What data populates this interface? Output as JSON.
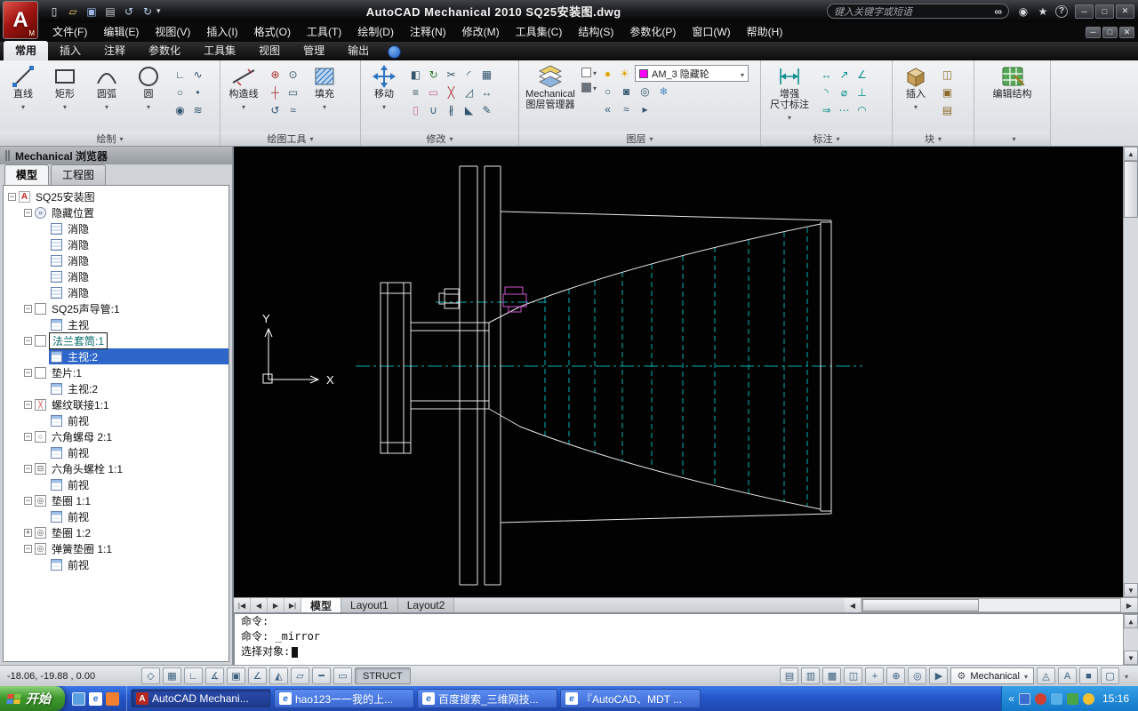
{
  "colors": {
    "selection_blue": "#2e66c9",
    "layer_swatch_magenta": "#ff00ff",
    "centerline_teal": "#00b3b3",
    "drawing_line_white": "#e6e6e6",
    "taskbar_blue": "#2457c9",
    "start_green": "#3f9c2e"
  },
  "title_bar": {
    "app_title": "AutoCAD Mechanical 2010  SQ25安装图.dwg",
    "search_placeholder": "键入关键字或短语",
    "qat_icons": [
      "qnew-icon",
      "open-icon",
      "save-icon",
      "plot-icon",
      "undo-icon",
      "redo-icon"
    ],
    "right_icons": [
      {
        "name": "communication-center-icon",
        "glyph": "◉"
      },
      {
        "name": "favorites-star-icon",
        "glyph": "★"
      },
      {
        "name": "help-icon",
        "glyph": "?"
      }
    ],
    "window_buttons": [
      {
        "name": "minimize-button",
        "glyph": "─"
      },
      {
        "name": "restore-button",
        "glyph": "□"
      },
      {
        "name": "close-button",
        "glyph": "✕"
      }
    ]
  },
  "menu_bar": {
    "items": [
      "文件(F)",
      "编辑(E)",
      "视图(V)",
      "插入(I)",
      "格式(O)",
      "工具(T)",
      "绘制(D)",
      "注释(N)",
      "修改(M)",
      "工具集(C)",
      "结构(S)",
      "参数化(P)",
      "窗口(W)",
      "帮助(H)"
    ],
    "child_window_buttons": [
      {
        "name": "child-minimize-button",
        "glyph": "─"
      },
      {
        "name": "child-restore-button",
        "glyph": "□"
      },
      {
        "name": "child-close-button",
        "glyph": "✕"
      }
    ]
  },
  "ribbon": {
    "tabs": [
      {
        "label": "常用",
        "active": true
      },
      {
        "label": "插入"
      },
      {
        "label": "注释"
      },
      {
        "label": "参数化"
      },
      {
        "label": "工具集"
      },
      {
        "label": "视图"
      },
      {
        "label": "管理"
      },
      {
        "label": "输出"
      }
    ],
    "panels": {
      "draw": {
        "label": "绘制",
        "line": "直线",
        "rect": "矩形",
        "arc": "圆弧",
        "circle": "圆",
        "small_icons": [
          "polyline-icon",
          "spline-icon",
          "ellipse-icon",
          "point-icon",
          "donut-icon",
          "revision-cloud-icon"
        ]
      },
      "drawtools": {
        "label": "绘图工具",
        "construction_line": "构造线",
        "hatch": "填充",
        "small_icons": [
          "centerline-cross-icon",
          "point-ref-icon",
          "centerline-icon",
          "rectangle-tool-icon",
          "undo-mark-icon",
          "zigzag-icon"
        ]
      },
      "modify": {
        "label": "修改",
        "move": "移动",
        "small_icons": [
          "mirror-icon",
          "rotate-icon",
          "trim-icon",
          "fillet-icon",
          "array-icon",
          "offset-icon",
          "erase-icon",
          "explode-icon",
          "scale-icon",
          "stretch-icon",
          "power-erase-icon",
          "join-icon",
          "break-icon",
          "chamfer-icon",
          "edit-poly-icon"
        ]
      },
      "layers": {
        "label": "图层",
        "manager_line1": "Mechanical",
        "manager_line2": "图层管理器",
        "layer_combo": "AM_3 隐藏轮",
        "row1_icons": [
          "bulb-icon",
          "sun-icon"
        ],
        "row2_icons": [
          "layer-off-icon",
          "layer-lock-icon",
          "layer-iso-icon",
          "freeze-icon"
        ],
        "row3_icons": [
          "layer-prev-icon",
          "layer-match-icon",
          "layer-walk-icon"
        ]
      },
      "annotate": {
        "label": "标注",
        "main_line1": "增强",
        "main_line2": "尺寸标注",
        "small_icons": [
          "dim-linear-icon",
          "dim-aligned-icon",
          "dim-angular-icon",
          "dim-radius-icon",
          "dim-diameter-icon",
          "dim-ordinate-icon",
          "dim-baseline-icon",
          "dim-chain-icon",
          "dim-arc-icon"
        ]
      },
      "block": {
        "label": "块",
        "insert": "插入",
        "small_icons": [
          "create-block-icon",
          "block-edit-icon",
          "attribute-icon"
        ]
      },
      "struct": {
        "label": "",
        "edit_structure": "编辑结构"
      }
    }
  },
  "browser_palette": {
    "title": "Mechanical 浏览器",
    "tabs": [
      {
        "label": "模型",
        "active": true
      },
      {
        "label": "工程图"
      }
    ],
    "tree": [
      {
        "level": 0,
        "exp": "minus",
        "icon": "am-drawing-icon",
        "label": "SQ25安装图"
      },
      {
        "level": 1,
        "exp": "minus",
        "icon": "hide-situation-icon",
        "label": "隐藏位置"
      },
      {
        "level": 2,
        "exp": "none",
        "icon": "hide-item-icon",
        "label": "消隐"
      },
      {
        "level": 2,
        "exp": "none",
        "icon": "hide-item-icon",
        "label": "消隐"
      },
      {
        "level": 2,
        "exp": "none",
        "icon": "hide-item-icon",
        "label": "消隐"
      },
      {
        "level": 2,
        "exp": "none",
        "icon": "hide-item-icon",
        "label": "消隐"
      },
      {
        "level": 2,
        "exp": "none",
        "icon": "hide-item-icon",
        "label": "消隐"
      },
      {
        "level": 1,
        "exp": "minus",
        "icon": "part-icon",
        "label": "SQ25声导管:1"
      },
      {
        "level": 2,
        "exp": "none",
        "icon": "view-icon",
        "label": "主视"
      },
      {
        "level": 1,
        "exp": "minus",
        "icon": "part-icon",
        "label": "法兰套筒:1",
        "boxed": true
      },
      {
        "level": 2,
        "exp": "none",
        "icon": "view-icon",
        "label": "主视:2",
        "selected": true
      },
      {
        "level": 1,
        "exp": "minus",
        "icon": "part-icon",
        "label": "垫片:1"
      },
      {
        "level": 2,
        "exp": "none",
        "icon": "view-icon",
        "label": "主视:2"
      },
      {
        "level": 1,
        "exp": "minus",
        "icon": "fastener-icon",
        "label": "螺纹联接1:1"
      },
      {
        "level": 2,
        "exp": "none",
        "icon": "view-icon",
        "label": "前视"
      },
      {
        "level": 1,
        "exp": "minus",
        "icon": "nut-icon",
        "label": "六角螺母 2:1"
      },
      {
        "level": 2,
        "exp": "none",
        "icon": "view-icon",
        "label": "前视"
      },
      {
        "level": 1,
        "exp": "minus",
        "icon": "bolt-icon",
        "label": "六角头螺栓 1:1"
      },
      {
        "level": 2,
        "exp": "none",
        "icon": "view-icon",
        "label": "前视"
      },
      {
        "level": 1,
        "exp": "minus",
        "icon": "washer-icon",
        "label": "垫圈 1:1"
      },
      {
        "level": 2,
        "exp": "none",
        "icon": "view-icon",
        "label": "前视"
      },
      {
        "level": 1,
        "exp": "plus",
        "icon": "washer-icon",
        "label": "垫圈 1:2"
      },
      {
        "level": 1,
        "exp": "minus",
        "icon": "washer-icon",
        "label": "弹簧垫圈 1:1"
      },
      {
        "level": 2,
        "exp": "none",
        "icon": "view-icon",
        "label": "前视"
      }
    ]
  },
  "drawing": {
    "ucs_x": "X",
    "ucs_y": "Y"
  },
  "layout_bar": {
    "nav_buttons": [
      {
        "name": "first-tab-button",
        "glyph": "|◀"
      },
      {
        "name": "prev-tab-button",
        "glyph": "◀"
      },
      {
        "name": "next-tab-button",
        "glyph": "▶"
      },
      {
        "name": "last-tab-button",
        "glyph": "▶|"
      }
    ],
    "tabs": [
      {
        "label": "模型",
        "active": true
      },
      {
        "label": "Layout1"
      },
      {
        "label": "Layout2"
      }
    ]
  },
  "scrollbar": {
    "up": "▲",
    "down": "▼",
    "left": "◀",
    "right": "▶"
  },
  "command_line": {
    "history": [
      "命令:",
      "命令: _mirror"
    ],
    "prompt": "选择对象:"
  },
  "status_bar": {
    "coordinates": "-18.06, -19.88 ,  0.00",
    "toggles": [
      "snap-icon",
      "grid-icon",
      "ortho-icon",
      "polar-icon",
      "osnap-icon",
      "otrack-icon",
      "ducs-icon",
      "dyn-icon",
      "lwt-icon",
      "qp-icon"
    ],
    "struct_label": "STRUCT",
    "right_icons_a": [
      "model-icon",
      "layout-icon",
      "quickview-drawings-icon",
      "quickview-layouts-icon",
      "pan-icon",
      "zoom-icon",
      "steeringwheel-icon",
      "showmotion-icon"
    ],
    "workspace": "Mechanical",
    "right_icons_b": [
      "annotation-visibility-icon",
      "annoscale-icon",
      "workspace-lock-icon",
      "cleanscreen-icon"
    ]
  },
  "taskbar": {
    "start_label": "开始",
    "quick_launch": [
      "show-desktop-icon",
      "ie-quick-icon",
      "media-player-icon"
    ],
    "tasks": [
      {
        "label": "AutoCAD Mechani...",
        "icon": "autocad-icon",
        "active": true
      },
      {
        "label": "hao123一一我的上...",
        "icon": "ie-icon"
      },
      {
        "label": "百度搜索_三维网技...",
        "icon": "ie-icon"
      },
      {
        "label": "『AutoCAD、MDT ...",
        "icon": "ie-icon"
      }
    ],
    "tray_chevron": "«",
    "tray_icons": [
      "language-icon",
      "antivirus-icon",
      "volume-icon",
      "network-icon",
      "update-icon"
    ],
    "clock": "15:16"
  }
}
